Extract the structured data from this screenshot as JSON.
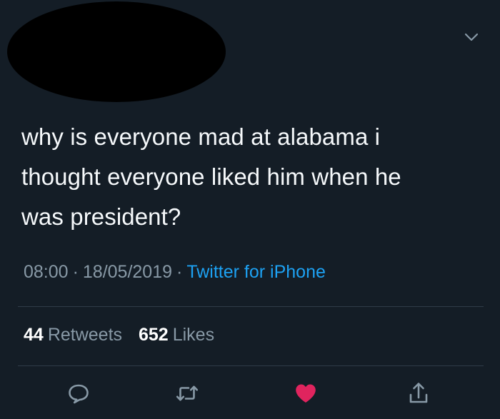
{
  "tweet": {
    "text_lines": [
      "why is everyone mad at alabama i",
      "thought everyone liked him when he",
      "was president?"
    ],
    "time": "08:00",
    "date": "18/05/2019",
    "separator": "·",
    "source": "Twitter for iPhone",
    "retweets_count": "44",
    "retweets_label": "Retweets",
    "likes_count": "652",
    "likes_label": "Likes"
  },
  "icons": {
    "menu": "chevron-down-icon",
    "reply": "reply-icon",
    "retweet": "retweet-icon",
    "like": "heart-icon",
    "share": "share-icon"
  },
  "colors": {
    "background": "#141d26",
    "text": "#f5f8fa",
    "muted": "#8899a6",
    "link": "#1da1f2",
    "like": "#e0245e",
    "redaction": "#000000"
  }
}
